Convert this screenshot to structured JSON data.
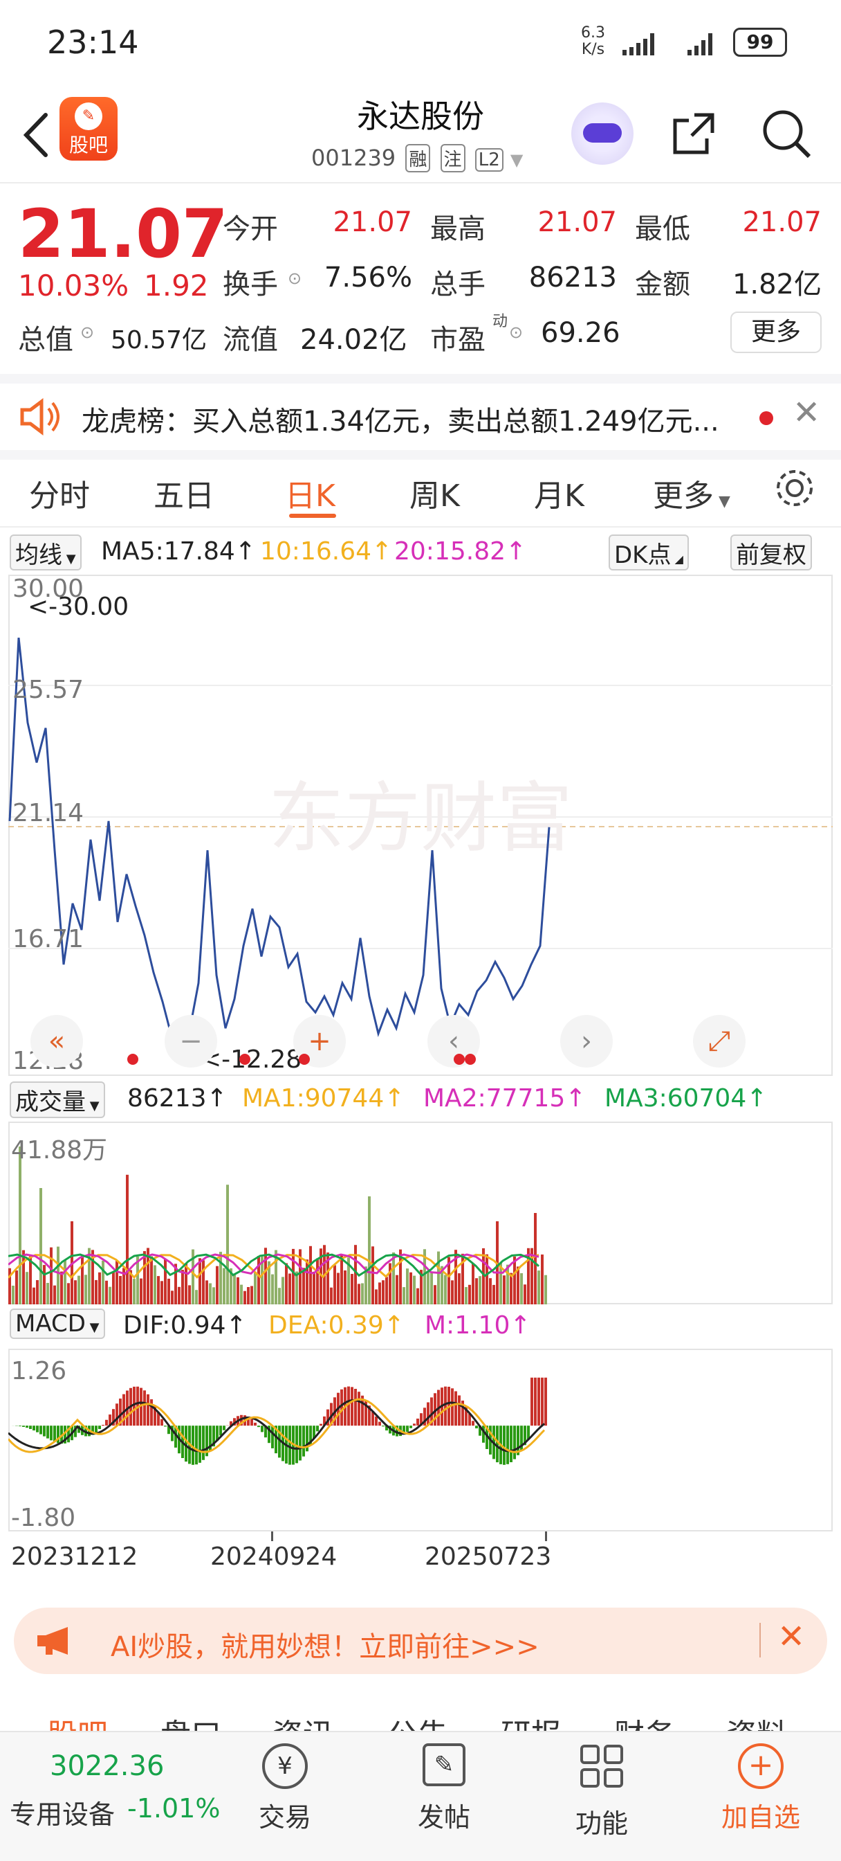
{
  "status_bar": {
    "time": "23:14",
    "net_speed_top": "6.3",
    "net_speed_bottom": "K/s",
    "battery": "99"
  },
  "header": {
    "logo_text": "股吧",
    "title": "永达股份",
    "code": "001239",
    "tags": [
      "融",
      "注",
      "L2"
    ]
  },
  "quote": {
    "price": "21.07",
    "change_pct": "10.03%",
    "change": "1.92",
    "fields": [
      {
        "label": "今开",
        "value": "21.07"
      },
      {
        "label": "最高",
        "value": "21.07"
      },
      {
        "label": "最低",
        "value": "21.07"
      },
      {
        "label": "换手",
        "value": "7.56%"
      },
      {
        "label": "总手",
        "value": "86213"
      },
      {
        "label": "金额",
        "value": "1.82亿"
      },
      {
        "label": "总值",
        "value": "50.57亿"
      },
      {
        "label": "流值",
        "value": "24.02亿"
      },
      {
        "label": "市盈",
        "value": "69.26"
      }
    ],
    "pe_superscript": "动",
    "more": "更多"
  },
  "notice": {
    "text": "龙虎榜：买入总额1.34亿元，卖出总额1.249亿元..."
  },
  "tabs": [
    {
      "label": "分时",
      "active": false
    },
    {
      "label": "五日",
      "active": false
    },
    {
      "label": "日K",
      "active": true
    },
    {
      "label": "周K",
      "active": false
    },
    {
      "label": "月K",
      "active": false
    },
    {
      "label": "更多",
      "active": false
    }
  ],
  "ma_bar": {
    "selector": "均线",
    "ma5": "MA5:17.84↑",
    "ma10": "10:16.64↑",
    "ma20": "20:15.82↑",
    "dk": "DK点",
    "adjust": "前复权"
  },
  "price_axis": [
    "30.00",
    "25.57",
    "21.14",
    "16.71",
    "12.28"
  ],
  "price_marks": {
    "high": "<-30.00",
    "low": "<-12.28"
  },
  "watermark": "东方财富",
  "volume_bar": {
    "selector": "成交量",
    "value": "86213↑",
    "ma1": "MA1:90744↑",
    "ma2": "MA2:77715↑",
    "ma3": "MA3:60704↑",
    "axis_top": "41.88万"
  },
  "macd_bar": {
    "selector": "MACD",
    "dif": "DIF:0.94↑",
    "dea": "DEA:0.39↑",
    "m": "M:1.10↑",
    "axis_top": "1.26",
    "axis_bottom": "-1.80"
  },
  "x_axis": [
    "20231212",
    "20240924",
    "20250723"
  ],
  "banner": {
    "text": "AI炒股，就用妙想！立即前往>>>"
  },
  "bottom_tabs": [
    "股吧",
    "盘口",
    "资讯",
    "公告",
    "研报",
    "财务",
    "资料"
  ],
  "bottom_bar": {
    "index_value": "3022.36",
    "index_name": "专用设备",
    "index_change": "-1.01%",
    "items": [
      "交易",
      "发帖",
      "功能",
      "加自选"
    ]
  },
  "colors": {
    "up": "#e0242b",
    "down": "#17a34a",
    "accent": "#f0632b",
    "ma5": "#222222",
    "ma10": "#f2b01e",
    "ma20": "#d62fb8"
  },
  "chart_data": {
    "type": "line",
    "title": "",
    "xlabel": "",
    "ylabel": "",
    "x": [
      "20231212",
      "20240924",
      "20250723"
    ],
    "ylim": [
      12.28,
      30.0
    ],
    "series": [
      {
        "name": "",
        "values": [
          21.3,
          28.2,
          25.0,
          23.5,
          24.8,
          20.2,
          15.9,
          18.2,
          17.2,
          20.6,
          18.3,
          21.3,
          17.5,
          19.3,
          18.1,
          17.0,
          15.6,
          14.5,
          13.2,
          12.6,
          13.4,
          15.2,
          20.2,
          15.5,
          13.5,
          14.6,
          16.6,
          18.0,
          16.2,
          17.7,
          17.3,
          15.8,
          16.3,
          14.5,
          14.1,
          14.7,
          14.0,
          15.2,
          14.6,
          16.9,
          14.7,
          13.3,
          14.2,
          13.5,
          14.8,
          14.1,
          15.5,
          20.2,
          15.0,
          13.6,
          14.4,
          14.0,
          14.9,
          15.3,
          16.0,
          15.4,
          14.6,
          15.1,
          15.9,
          16.6,
          21.07
        ]
      },
      {
        "name": "MA5",
        "values": [
          17.84
        ]
      },
      {
        "name": "MA10",
        "values": [
          16.64
        ]
      },
      {
        "name": "MA20",
        "values": [
          15.82
        ]
      }
    ],
    "volume": {
      "last": 86213,
      "ma1": 90744,
      "ma2": 77715,
      "ma3": 60704,
      "max": 418800
    },
    "macd": {
      "dif": 0.94,
      "dea": 0.39,
      "m": 1.1,
      "ylim": [
        -1.8,
        1.26
      ]
    }
  }
}
